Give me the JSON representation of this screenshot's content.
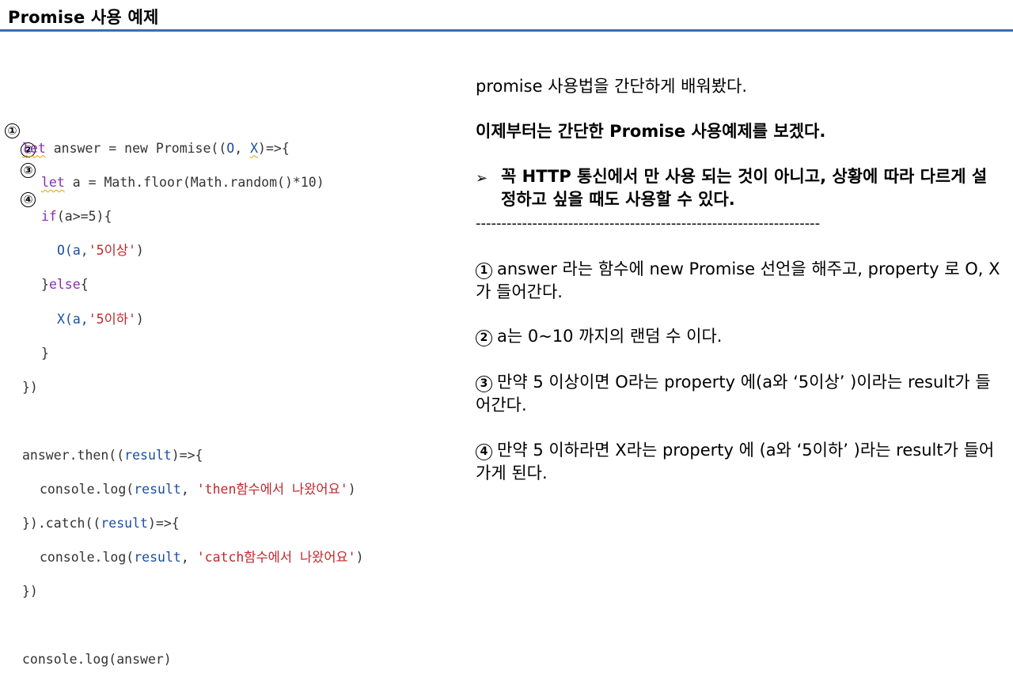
{
  "slide_title": "Promise 사용 예제",
  "code_lines": {
    "l1_a": "let",
    "l1_b": " answer = new Promise((",
    "l1_c": "O",
    "l1_d": ", ",
    "l1_e": "X",
    "l1_f": ")=>{",
    "l2_a": "let",
    "l2_b": " a = Math.floor(Math.random()*10)",
    "l3_a": "if",
    "l3_b": "(a>=5){",
    "l4_a": "O(a,",
    "l4_b": "'5이상'",
    "l4_c": ")",
    "l5_a": "}",
    "l5_b": "else",
    "l5_c": "{",
    "l6_a": "X(a,",
    "l6_b": "'5이하'",
    "l6_c": ")",
    "l7": "}",
    "l8": "})",
    "l9_a": "answer.then((",
    "l9_b": "result",
    "l9_c": ")=>{",
    "l10_a": "console.log(",
    "l10_b": "result",
    "l10_c": ", ",
    "l10_d": "'then함수에서 나왔어요'",
    "l10_e": ")",
    "l11_a": "}).catch((",
    "l11_b": "result",
    "l11_c": ")=>{",
    "l12_a": "console.log(",
    "l12_b": "result",
    "l12_c": ", ",
    "l12_d": "'catch함수에서 나왔어요'",
    "l12_e": ")",
    "l13": "})",
    "l14": "console.log(answer)"
  },
  "markers": [
    "①",
    "②",
    "③",
    "④"
  ],
  "intro": "promise 사용법을 간단하게 배워봤다.",
  "lead": "이제부터는 간단한 Promise 사용예제를 보겠다.",
  "bullet_symbol": "➢",
  "bullet_text": "꼭 HTTP 통신에서 만 사용 되는 것이 아니고, 상황에 따라 다르게 설정하고 싶을 때도 사용할 수 있다.",
  "divider": "-------------------------------------------------------------------",
  "items": [
    {
      "num": "1",
      "text": "answer 라는 함수에 new Promise 선언을 해주고, property 로 O, X가 들어간다."
    },
    {
      "num": "2",
      "text": "a는 0~10 까지의 랜덤 수 이다."
    },
    {
      "num": "3",
      "text": "만약 5 이상이면 O라는 property 에(a와 ‘5이상’ )이라는 result가 들어간다."
    },
    {
      "num": "4",
      "text": "만약 5 이하라면 X라는 property 에 (a와 ‘5이하’ )라는 result가 들어가게 된다."
    }
  ]
}
